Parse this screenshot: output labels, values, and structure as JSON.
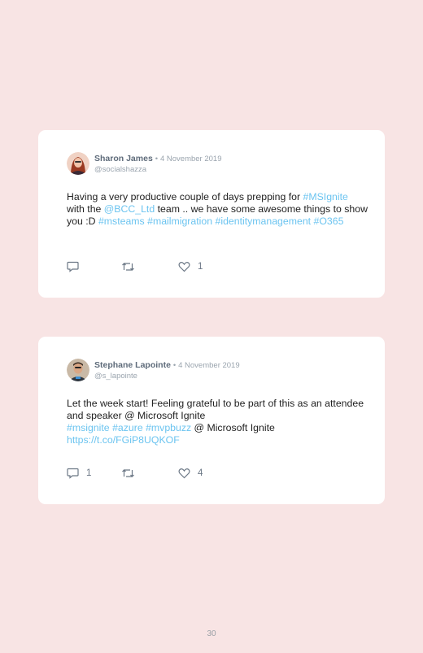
{
  "page": {
    "number": "30"
  },
  "tweets": [
    {
      "author": "Sharon James",
      "separator": "•",
      "date": "4 November 2019",
      "handle": "@socialshazza",
      "body": [
        {
          "t": "Having a very productive couple of days prepping for ",
          "link": false
        },
        {
          "t": "#MSIgnite",
          "link": true
        },
        {
          "t": " with the ",
          "link": false
        },
        {
          "t": "@BCC_Ltd",
          "link": true
        },
        {
          "t": " team .. we have some awesome things to show you :D ",
          "link": false
        },
        {
          "t": "#msteams",
          "link": true
        },
        {
          "t": " ",
          "link": false
        },
        {
          "t": "#mailmigration",
          "link": true
        },
        {
          "t": " ",
          "link": false
        },
        {
          "t": "#identitymanagement",
          "link": true
        },
        {
          "t": " ",
          "link": false
        },
        {
          "t": "#O365",
          "link": true
        }
      ],
      "replies": "",
      "retweets": "",
      "likes": "1"
    },
    {
      "author": "Stephane Lapointe",
      "separator": "•",
      "date": "4 November 2019",
      "handle": "@s_lapointe",
      "body": [
        {
          "t": "Let the week start! Feeling grateful to be part of this as an attendee and speaker @ Microsoft Ignite",
          "link": false
        },
        {
          "br": true
        },
        {
          "t": "#msignite",
          "link": true
        },
        {
          "t": " ",
          "link": false
        },
        {
          "t": "#azure",
          "link": true
        },
        {
          "t": " ",
          "link": false
        },
        {
          "t": "#mvpbuzz",
          "link": true
        },
        {
          "t": " @ Microsoft Ignite",
          "link": false
        },
        {
          "br": true
        },
        {
          "t": "https://t.co/FGiP8UQKOF",
          "link": true
        }
      ],
      "replies": "1",
      "retweets": "",
      "likes": "4"
    }
  ],
  "colors": {
    "background": "#f8e4e4",
    "card": "#ffffff",
    "link": "#6cc4f0",
    "meta": "#9aa4ae"
  },
  "icons": {
    "reply": "reply-icon",
    "retweet": "retweet-icon",
    "like": "heart-icon"
  }
}
